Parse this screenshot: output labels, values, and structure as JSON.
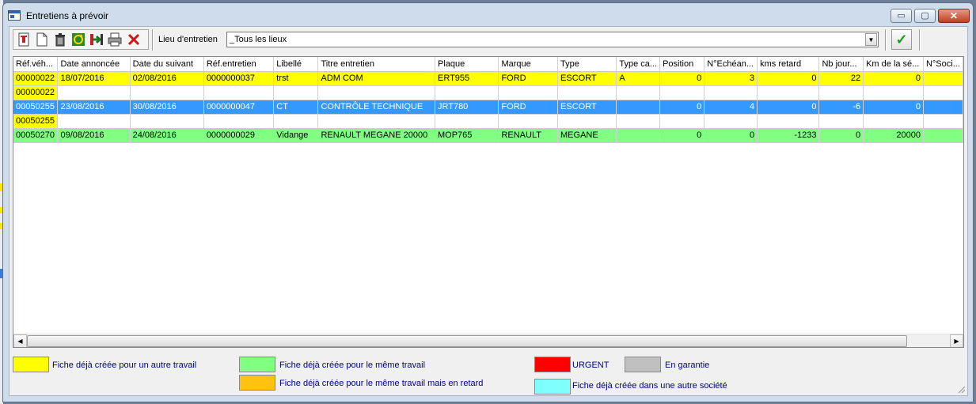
{
  "window": {
    "title": "Entretiens à prévoir"
  },
  "titlebar_buttons": {
    "minimize": "▭",
    "maximize": "▢",
    "close": "✕"
  },
  "toolbar": {
    "buttons": [
      {
        "icon": "open-record-icon"
      },
      {
        "icon": "new-document-icon"
      },
      {
        "icon": "trash-icon"
      },
      {
        "icon": "refresh-icon"
      },
      {
        "icon": "export-icon"
      },
      {
        "icon": "print-icon"
      },
      {
        "icon": "delete-x-icon"
      }
    ],
    "lieu_label": "Lieu d'entretien",
    "lieu_value": "_Tous les lieux",
    "validate_icon": "✓"
  },
  "colors": {
    "yellow": "#ffff00",
    "blue": "#3399ff",
    "green": "#80ff80",
    "orange": "#ffc20e",
    "red": "#ff0000",
    "grey": "#c0c0c0",
    "cyan": "#80ffff"
  },
  "grid": {
    "columns": [
      "Réf.véh...",
      "Date annoncée",
      "Date du suivant",
      "Réf.entretien",
      "Libellé",
      "Titre entretien",
      "Plaque",
      "Marque",
      "Type",
      "Type ca...",
      "Position",
      "N°Echéan...",
      "kms retard",
      "Nb jour...",
      "Km de la sé...",
      "N°Soci..."
    ],
    "numeric_columns": [
      10,
      11,
      12,
      13,
      14
    ],
    "rows": [
      {
        "color": "yellow",
        "text": "#000000",
        "cells": [
          "00000022",
          "18/07/2016",
          "02/08/2016",
          "0000000037",
          "trst",
          "ADM COM",
          "ERT955",
          "FORD",
          "ESCORT",
          "A",
          "0",
          "3",
          "0",
          "22",
          "0",
          ""
        ]
      },
      {
        "color": "yellow",
        "cells_fill": "first",
        "text": "#000000",
        "cells": [
          "00000022",
          "",
          "",
          "",
          "",
          "",
          "",
          "",
          "",
          "",
          "",
          "",
          "",
          "",
          "",
          ""
        ]
      },
      {
        "color": "blue",
        "text": "#ffffff",
        "cells": [
          "00050255",
          "23/08/2016",
          "30/08/2016",
          "0000000047",
          "CT",
          "CONTRÔLE TECHNIQUE",
          "JRT780",
          "FORD",
          "ESCORT",
          "",
          "0",
          "4",
          "0",
          "-6",
          "0",
          ""
        ]
      },
      {
        "color": "yellow",
        "cells_fill": "first",
        "text": "#000000",
        "cells": [
          "00050255",
          "",
          "",
          "",
          "",
          "",
          "",
          "",
          "",
          "",
          "",
          "",
          "",
          "",
          "",
          ""
        ]
      },
      {
        "color": "green",
        "text": "#000000",
        "cells": [
          "00050270",
          "09/08/2016",
          "24/08/2016",
          "0000000029",
          "Vidange",
          "RENAULT MEGANE 20000",
          "MOP765",
          "RENAULT",
          "MEGANE",
          "",
          "0",
          "0",
          "-1233",
          "0",
          "20000",
          ""
        ]
      }
    ]
  },
  "scrollbar": {
    "left_arrow": "◀",
    "right_arrow": "▶"
  },
  "legend": {
    "autre_travail": "Fiche déjà créée pour un autre travail",
    "meme_travail": "Fiche déjà créée pour le même travail",
    "meme_travail_retard": "Fiche déjà créée pour le même travail mais en retard",
    "urgent": "URGENT",
    "garantie": "En garantie",
    "autre_societe": "Fiche déjà créée dans une autre société"
  }
}
